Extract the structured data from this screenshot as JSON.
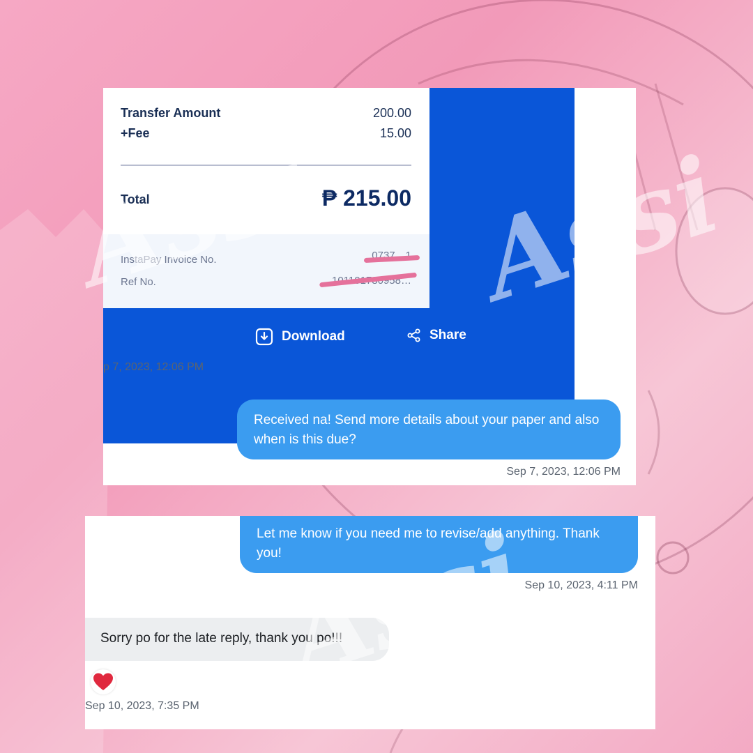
{
  "watermark": "Assi",
  "receipt": {
    "transfer_amount_label": "Transfer Amount",
    "transfer_amount_value": "200.00",
    "fee_label": "+Fee",
    "fee_value": "15.00",
    "total_label": "Total",
    "total_value": "₱ 215.00",
    "invoice_label": "InstaPay Invoice No.",
    "invoice_value_masked": "0737…1",
    "ref_label": "Ref No.",
    "ref_value_masked": "101101780958…",
    "download_label": "Download",
    "share_label": "Share"
  },
  "messages_1": {
    "receipt_timestamp": "p 7, 2023, 12:06 PM",
    "outgoing_text": "Received na! Send more details about your paper and also when is this due?",
    "outgoing_timestamp": "Sep 7, 2023, 12:06 PM"
  },
  "messages_2": {
    "outgoing_text": "Let me know if you need me to revise/add anything. Thank you!",
    "outgoing_timestamp": "Sep 10, 2023, 4:11 PM",
    "incoming_text": "Sorry po for the late reply, thank you po!!!",
    "incoming_timestamp": "Sep 10, 2023, 7:35 PM",
    "reaction_icon": "heart-icon"
  },
  "colors": {
    "receipt_blue": "#0a56d8",
    "bubble_blue": "#3b9cf0",
    "bubble_gray": "#eceef0",
    "heart_red": "#e0283e",
    "background_pink": "#f29ab9"
  }
}
